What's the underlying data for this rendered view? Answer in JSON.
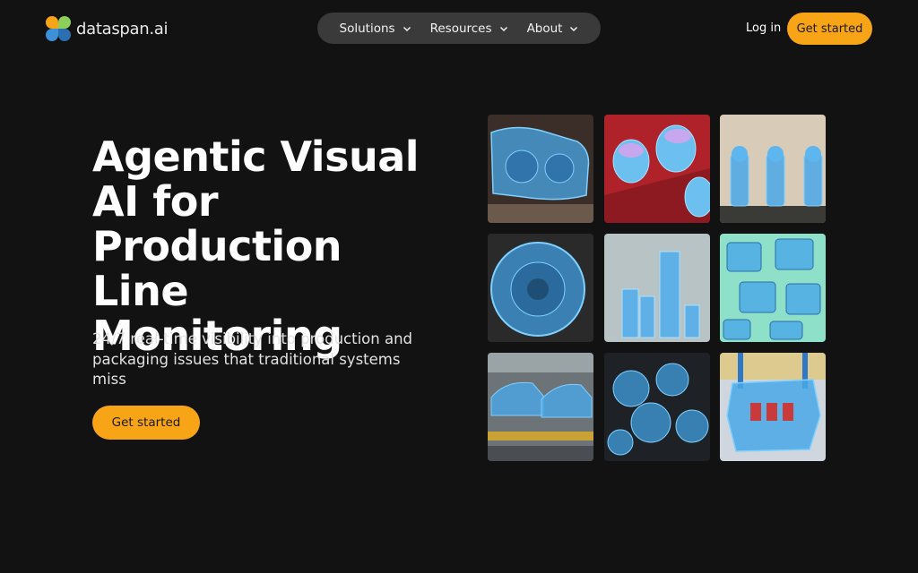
{
  "brand": {
    "name": "dataspan.ai"
  },
  "nav": {
    "items": [
      {
        "label": "Solutions"
      },
      {
        "label": "Resources"
      },
      {
        "label": "About"
      }
    ]
  },
  "header": {
    "login_label": "Log in",
    "cta_label": "Get started"
  },
  "hero": {
    "title_lines": [
      "Agentic Visual",
      "AI for",
      "Production Line",
      "Monitoring"
    ],
    "subtitle": "24/7 real-time visibility into production and packaging issues that traditional systems miss",
    "cta_label": "Get started"
  },
  "colors": {
    "accent": "#f7a416",
    "background": "#121212",
    "nav_pill": "#3a3a3a",
    "mask_blue": "#4aa8e8"
  },
  "gallery": [
    {
      "icon": "train-bogie-image"
    },
    {
      "icon": "capacitors-image"
    },
    {
      "icon": "bottle-caps-image"
    },
    {
      "icon": "gear-wheel-image"
    },
    {
      "icon": "shafts-image"
    },
    {
      "icon": "chip-boards-image"
    },
    {
      "icon": "car-assembly-image"
    },
    {
      "icon": "gears-cluster-image"
    },
    {
      "icon": "circuit-board-image"
    }
  ]
}
